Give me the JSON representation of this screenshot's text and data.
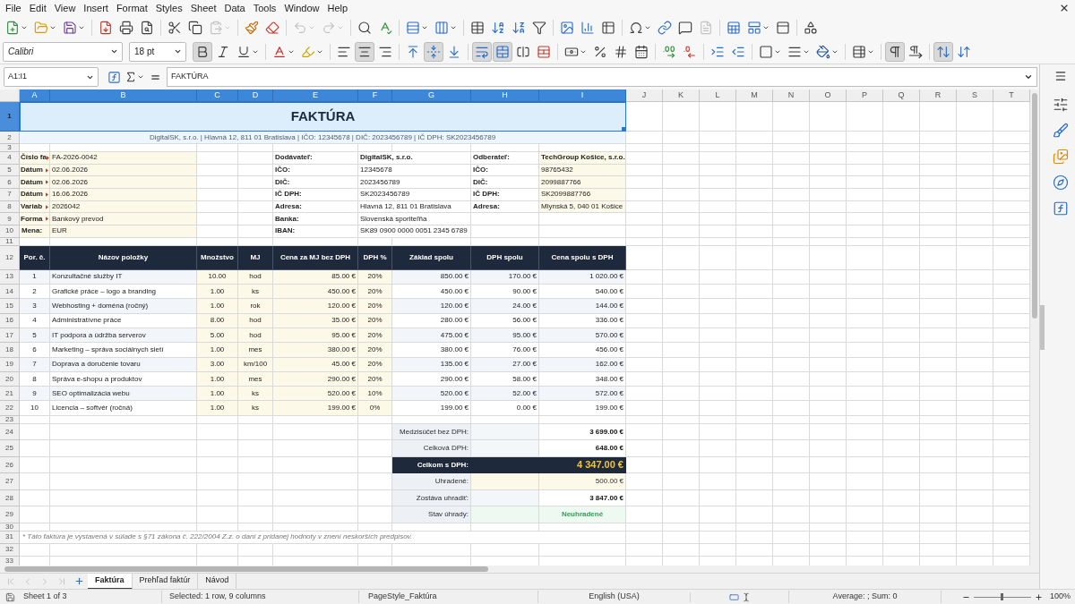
{
  "menu_bar": [
    "File",
    "Edit",
    "View",
    "Insert",
    "Format",
    "Styles",
    "Sheet",
    "Data",
    "Tools",
    "Window",
    "Help"
  ],
  "standard_toolbar": {
    "paste_disabled": true,
    "undo_disabled": true,
    "redo_disabled": true,
    "header_footer_disabled": true
  },
  "formatting_toolbar": {
    "font_name": "Calibri",
    "font_size": "18 pt",
    "bold": true,
    "italic": false,
    "underline": false,
    "align_left": false,
    "align_center": true,
    "align_right": false,
    "align_top": false,
    "align_middle": true,
    "align_bottom": false,
    "wrap_text": true,
    "merge_and_center": true,
    "paragraph_left_to_right": true,
    "paragraph_right_to_left": false,
    "text_left_to_right": true,
    "text_top_to_bottom": false
  },
  "formula_bar": {
    "name_box": "A1:I1",
    "content": "FAKTÚRA"
  },
  "sheet": {
    "columns": [
      {
        "label": "A",
        "selected": true
      },
      {
        "label": "B",
        "selected": true
      },
      {
        "label": "C",
        "selected": true
      },
      {
        "label": "D",
        "selected": true
      },
      {
        "label": "E",
        "selected": true
      },
      {
        "label": "F",
        "selected": true
      },
      {
        "label": "G",
        "selected": true
      },
      {
        "label": "H",
        "selected": true
      },
      {
        "label": "I",
        "selected": true
      },
      {
        "label": "J",
        "selected": false
      },
      {
        "label": "K",
        "selected": false
      },
      {
        "label": "L",
        "selected": false
      },
      {
        "label": "M",
        "selected": false
      },
      {
        "label": "N",
        "selected": false
      },
      {
        "label": "O",
        "selected": false
      },
      {
        "label": "P",
        "selected": false
      },
      {
        "label": "Q",
        "selected": false
      },
      {
        "label": "R",
        "selected": false
      },
      {
        "label": "S",
        "selected": false
      },
      {
        "label": "T",
        "selected": false
      }
    ],
    "rows": [
      {
        "label": "1",
        "selected": true
      },
      {
        "label": "2",
        "selected": false
      },
      {
        "label": "3",
        "selected": false
      },
      {
        "label": "4",
        "selected": false
      },
      {
        "label": "5",
        "selected": false
      },
      {
        "label": "6",
        "selected": false
      },
      {
        "label": "7",
        "selected": false
      },
      {
        "label": "8",
        "selected": false
      },
      {
        "label": "9",
        "selected": false
      },
      {
        "label": "10",
        "selected": false
      },
      {
        "label": "11",
        "selected": false
      },
      {
        "label": "12",
        "selected": false
      },
      {
        "label": "13",
        "selected": false
      },
      {
        "label": "14",
        "selected": false
      },
      {
        "label": "15",
        "selected": false
      },
      {
        "label": "16",
        "selected": false
      },
      {
        "label": "17",
        "selected": false
      },
      {
        "label": "18",
        "selected": false
      },
      {
        "label": "19",
        "selected": false
      },
      {
        "label": "20",
        "selected": false
      },
      {
        "label": "21",
        "selected": false
      },
      {
        "label": "22",
        "selected": false
      },
      {
        "label": "23",
        "selected": false
      },
      {
        "label": "24",
        "selected": false
      },
      {
        "label": "25",
        "selected": false
      },
      {
        "label": "26",
        "selected": false
      },
      {
        "label": "27",
        "selected": false
      },
      {
        "label": "28",
        "selected": false
      },
      {
        "label": "29",
        "selected": false
      },
      {
        "label": "30",
        "selected": false
      },
      {
        "label": "31",
        "selected": false
      },
      {
        "label": "32",
        "selected": false
      },
      {
        "label": "33",
        "selected": false
      }
    ],
    "title": {
      "text": "FAKTÚRA",
      "selected": true
    },
    "company_line": "DigitalSK, s.r.o. | Hlavná 12, 811 01 Bratislava | IČO: 12345678 | DIČ: 2023456789 | IČ DPH: SK2023456789",
    "invoice_fields": [
      {
        "label": "Číslo fa",
        "value": "FA-2026-0042",
        "clipped": true
      },
      {
        "label": "Dátum",
        "value": "02.06.2026",
        "clipped": true
      },
      {
        "label": "Dátum",
        "value": "02.06.2026",
        "clipped": true
      },
      {
        "label": "Dátum",
        "value": "16.06.2026",
        "clipped": true
      },
      {
        "label": "Variab",
        "value": "2026042",
        "clipped": true
      },
      {
        "label": "Forma",
        "value": "Bankový prevod",
        "clipped": true
      },
      {
        "label": "Mena:",
        "value": "EUR",
        "clipped": false
      }
    ],
    "supplier": {
      "heading": "Dodávateľ:",
      "name": "DigitalSK, s.r.o.",
      "fields": [
        {
          "label": "IČO:",
          "value": "12345678"
        },
        {
          "label": "DIČ:",
          "value": "2023456789"
        },
        {
          "label": "IČ DPH:",
          "value": "SK2023456789"
        },
        {
          "label": "Adresa:",
          "value": "Hlavná 12, 811 01 Bratislava"
        },
        {
          "label": "Banka:",
          "value": "Slovenská sporiteľňa"
        },
        {
          "label": "IBAN:",
          "value": "SK89 0900 0000 0051 2345 6789"
        }
      ]
    },
    "customer": {
      "heading": "Odberateľ:",
      "name": "TechGroup Košice, s.r.o.",
      "fields": [
        {
          "label": "IČO:",
          "value": "98765432"
        },
        {
          "label": "DIČ:",
          "value": "2099887766"
        },
        {
          "label": "IČ DPH:",
          "value": "SK2099887766"
        },
        {
          "label": "Adresa:",
          "value": "Mlynská 5, 040 01 Košice"
        }
      ]
    },
    "items_header": [
      "Por. č.",
      "Názov položky",
      "Množstvo",
      "MJ",
      "Cena za MJ bez DPH",
      "DPH %",
      "Základ spolu",
      "DPH spolu",
      "Cena spolu s DPH"
    ],
    "items": [
      {
        "no": "1",
        "name": "Konzultačné služby IT",
        "quantity": "10.00",
        "unit": "hod",
        "unit_price": "85.00 €",
        "vat_rate": "20%",
        "base": "850.00 €",
        "vat": "170.00 €",
        "total": "1 020.00 €"
      },
      {
        "no": "2",
        "name": "Grafické práce – logo a branding",
        "quantity": "1.00",
        "unit": "ks",
        "unit_price": "450.00 €",
        "vat_rate": "20%",
        "base": "450.00 €",
        "vat": "90.00 €",
        "total": "540.00 €"
      },
      {
        "no": "3",
        "name": "Webhosting + doména (ročný)",
        "quantity": "1.00",
        "unit": "rok",
        "unit_price": "120.00 €",
        "vat_rate": "20%",
        "base": "120.00 €",
        "vat": "24.00 €",
        "total": "144.00 €"
      },
      {
        "no": "4",
        "name": "Administratívne práce",
        "quantity": "8.00",
        "unit": "hod",
        "unit_price": "35.00 €",
        "vat_rate": "20%",
        "base": "280.00 €",
        "vat": "56.00 €",
        "total": "336.00 €"
      },
      {
        "no": "5",
        "name": "IT podpora a údržba serverov",
        "quantity": "5.00",
        "unit": "hod",
        "unit_price": "95.00 €",
        "vat_rate": "20%",
        "base": "475.00 €",
        "vat": "95.00 €",
        "total": "570.00 €"
      },
      {
        "no": "6",
        "name": "Marketing – správa sociálnych sietí",
        "quantity": "1.00",
        "unit": "mes",
        "unit_price": "380.00 €",
        "vat_rate": "20%",
        "base": "380.00 €",
        "vat": "76.00 €",
        "total": "456.00 €"
      },
      {
        "no": "7",
        "name": "Doprava a doručenie tovaru",
        "quantity": "3.00",
        "unit": "km/100",
        "unit_price": "45.00 €",
        "vat_rate": "20%",
        "base": "135.00 €",
        "vat": "27.00 €",
        "total": "162.00 €"
      },
      {
        "no": "8",
        "name": "Správa e-shopu a produktov",
        "quantity": "1.00",
        "unit": "mes",
        "unit_price": "290.00 €",
        "vat_rate": "20%",
        "base": "290.00 €",
        "vat": "58.00 €",
        "total": "348.00 €"
      },
      {
        "no": "9",
        "name": "SEO optimalizácia webu",
        "quantity": "1.00",
        "unit": "ks",
        "unit_price": "520.00 €",
        "vat_rate": "10%",
        "base": "520.00 €",
        "vat": "52.00 €",
        "total": "572.00 €"
      },
      {
        "no": "10",
        "name": "Licencia – softvér (ročná)",
        "quantity": "1.00",
        "unit": "ks",
        "unit_price": "199.00 €",
        "vat_rate": "0%",
        "base": "199.00 €",
        "vat": "0.00 €",
        "total": "199.00 €"
      }
    ],
    "summary": [
      {
        "label": "Medzisúčet bez DPH:",
        "value": "3 699.00 €",
        "kind": "subtotal"
      },
      {
        "label": "Celková DPH:",
        "value": "648.00 €",
        "kind": "subtotal"
      },
      {
        "label": "Celkom s DPH:",
        "value": "4 347.00 €",
        "kind": "grand_total"
      },
      {
        "label": "Uhradené:",
        "value": "500.00 €",
        "kind": "input"
      },
      {
        "label": "Zostáva uhradiť:",
        "value": "3 847.00 €",
        "kind": "subtotal"
      },
      {
        "label": "Stav úhrady:",
        "value": "Neuhradené",
        "kind": "status"
      }
    ],
    "footnote": "* Táto faktúra je vystavená v súlade s §71 zákona č. 222/2004 Z.z. o dani z pridanej hodnoty v znení neskorších predpisov."
  },
  "sheet_tab_bar": {
    "navigation_disabled": true,
    "tabs": [
      {
        "label": "Faktúra",
        "selected": true
      },
      {
        "label": "Prehľad faktúr",
        "selected": false
      },
      {
        "label": "Návod",
        "selected": false
      }
    ]
  },
  "status_bar": {
    "sheet": "Sheet 1 of 3",
    "selection": "Selected: 1 row, 9 columns",
    "page_style": "PageStyle_Faktúra",
    "language": "English (USA)",
    "statistics": "Average: ; Sum: 0",
    "zoom_slider": {
      "level": 0.5
    },
    "zoom": "100%"
  }
}
